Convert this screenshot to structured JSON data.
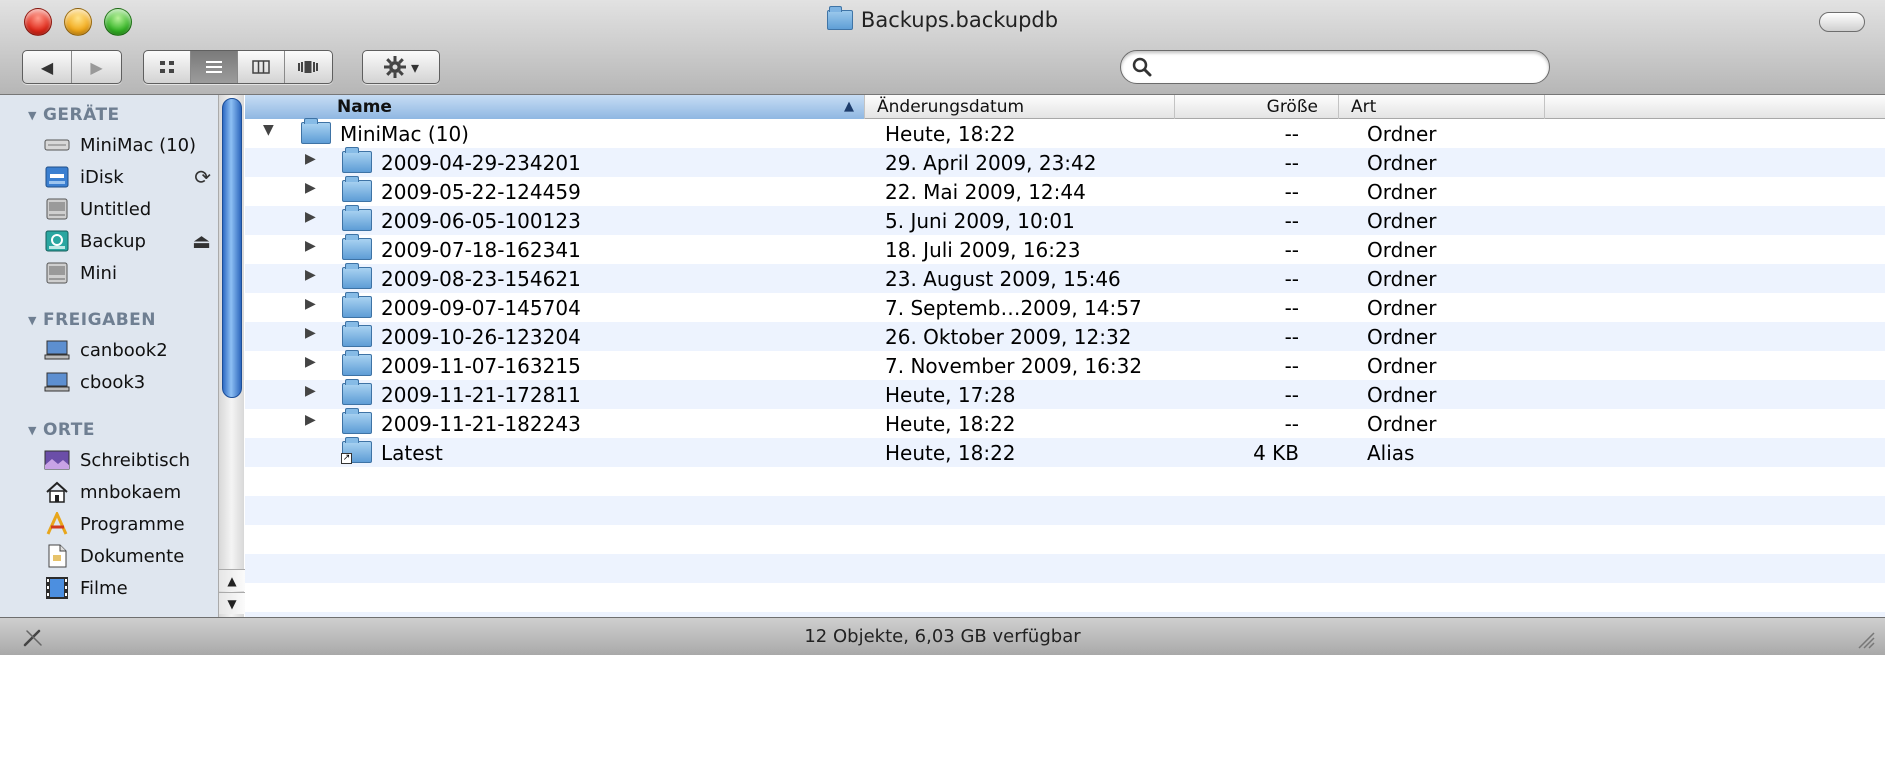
{
  "window": {
    "title": "Backups.backupdb"
  },
  "toolbar": {
    "back_icon": "◀",
    "forward_icon": "▶",
    "views": [
      "icon-view",
      "list-view",
      "column-view",
      "cover-flow-view"
    ],
    "active_view": "list-view",
    "action_icon": "gear-icon",
    "action_arrow": "▾",
    "search_placeholder": ""
  },
  "sidebar": {
    "sections": [
      {
        "label": "GERÄTE"
      },
      {
        "label": "FREIGABEN"
      },
      {
        "label": "ORTE"
      }
    ],
    "devices": [
      {
        "label": "MiniMac (10)",
        "icon": "drive-icon"
      },
      {
        "label": "iDisk",
        "icon": "idisk-icon",
        "badge": "⟳"
      },
      {
        "label": "Untitled",
        "icon": "disk-icon"
      },
      {
        "label": "Backup",
        "icon": "backup-drive-icon",
        "badge": "⏏"
      },
      {
        "label": "Mini",
        "icon": "disk-icon"
      }
    ],
    "shares": [
      {
        "label": "canbook2",
        "icon": "computer-icon"
      },
      {
        "label": "cbook3",
        "icon": "computer-icon"
      }
    ],
    "places": [
      {
        "label": "Schreibtisch",
        "icon": "desktop-icon"
      },
      {
        "label": "mnbokaem",
        "icon": "home-icon"
      },
      {
        "label": "Programme",
        "icon": "applications-icon"
      },
      {
        "label": "Dokumente",
        "icon": "documents-icon"
      },
      {
        "label": "Filme",
        "icon": "movies-icon"
      }
    ]
  },
  "columns": {
    "name": "Name",
    "date": "Änderungsdatum",
    "size": "Größe",
    "kind": "Art"
  },
  "rows": [
    {
      "name": "MiniMac (10)",
      "date": "Heute, 18:22",
      "size": "--",
      "kind": "Ordner",
      "expanded": true,
      "level": 0
    },
    {
      "name": "2009-04-29-234201",
      "date": "29. April 2009, 23:42",
      "size": "--",
      "kind": "Ordner",
      "level": 1
    },
    {
      "name": "2009-05-22-124459",
      "date": "22. Mai 2009, 12:44",
      "size": "--",
      "kind": "Ordner",
      "level": 1
    },
    {
      "name": "2009-06-05-100123",
      "date": "5. Juni 2009, 10:01",
      "size": "--",
      "kind": "Ordner",
      "level": 1
    },
    {
      "name": "2009-07-18-162341",
      "date": "18. Juli 2009, 16:23",
      "size": "--",
      "kind": "Ordner",
      "level": 1
    },
    {
      "name": "2009-08-23-154621",
      "date": "23. August 2009, 15:46",
      "size": "--",
      "kind": "Ordner",
      "level": 1
    },
    {
      "name": "2009-09-07-145704",
      "date": "7. Septemb…2009, 14:57",
      "size": "--",
      "kind": "Ordner",
      "level": 1
    },
    {
      "name": "2009-10-26-123204",
      "date": "26. Oktober 2009, 12:32",
      "size": "--",
      "kind": "Ordner",
      "level": 1
    },
    {
      "name": "2009-11-07-163215",
      "date": "7. November 2009, 16:32",
      "size": "--",
      "kind": "Ordner",
      "level": 1
    },
    {
      "name": "2009-11-21-172811",
      "date": "Heute, 17:28",
      "size": "--",
      "kind": "Ordner",
      "level": 1
    },
    {
      "name": "2009-11-21-182243",
      "date": "Heute, 18:22",
      "size": "--",
      "kind": "Ordner",
      "level": 1
    },
    {
      "name": "Latest",
      "date": "Heute, 18:22",
      "size": "4 KB",
      "kind": "Alias",
      "level": 1,
      "alias": true
    }
  ],
  "status": {
    "text": "12 Objekte, 6,03 GB verfügbar"
  }
}
